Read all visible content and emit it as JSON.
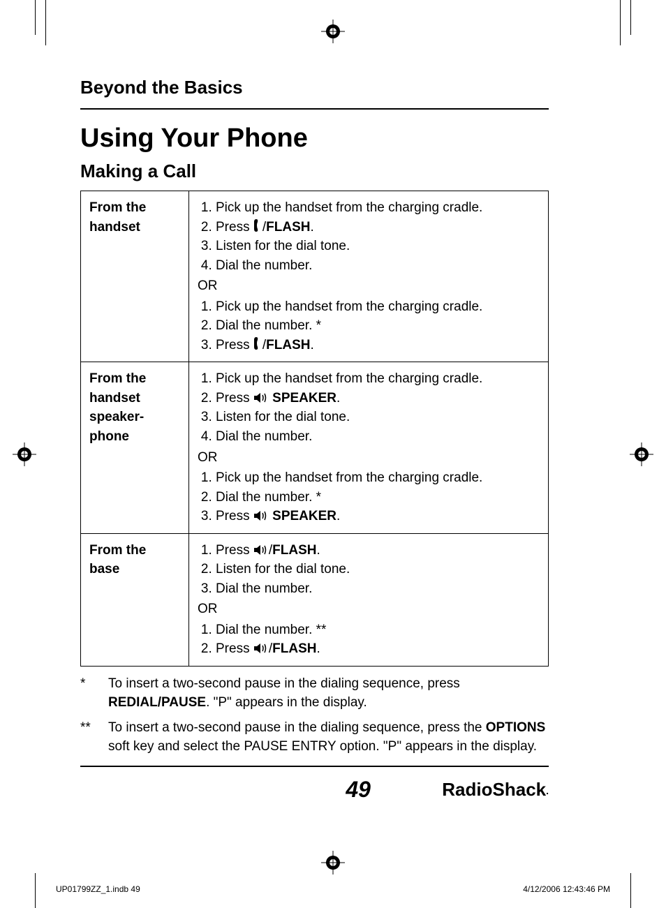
{
  "section_title": "Beyond the Basics",
  "main_title": "Using Your Phone",
  "sub_title": "Making a Call",
  "rows": [
    {
      "label": "From the handset",
      "steps_a": [
        "Pick up the handset from the charging cradle.",
        {
          "pre": "Press ",
          "icon": "handset",
          "post": "/",
          "bold": "FLASH",
          "end": "."
        },
        "Listen for the dial tone.",
        "Dial the number."
      ],
      "or": "OR",
      "steps_b": [
        "Pick up the handset from the charging cradle.",
        "Dial the number. *",
        {
          "pre": "Press ",
          "icon": "handset",
          "post": "/",
          "bold": "FLASH",
          "end": "."
        }
      ]
    },
    {
      "label": "From the handset speaker-phone",
      "steps_a": [
        "Pick up the handset from the charging cradle.",
        {
          "pre": "Press ",
          "icon": "speaker",
          "post": " ",
          "bold": "SPEAKER",
          "end": "."
        },
        "Listen for the dial tone.",
        "Dial the number."
      ],
      "or": "OR",
      "steps_b": [
        "Pick up the handset from the charging cradle.",
        "Dial the number. *",
        {
          "pre": "Press ",
          "icon": "speaker",
          "post": " ",
          "bold": "SPEAKER",
          "end": "."
        }
      ]
    },
    {
      "label": "From the base",
      "steps_a": [
        {
          "pre": "Press ",
          "icon": "speaker",
          "post": "/",
          "bold": "FLASH",
          "end": "."
        },
        "Listen for the dial tone.",
        "Dial the number."
      ],
      "or": "OR",
      "steps_b": [
        "Dial the number. **",
        {
          "pre": "Press ",
          "icon": "speaker",
          "post": "/",
          "bold": "FLASH",
          "end": "."
        }
      ]
    }
  ],
  "footnotes": [
    {
      "mark": "*",
      "text_pre": "To insert a two-second pause in the dialing sequence, press ",
      "bold": "REDIAL/PAUSE",
      "text_post": ". \"P\" appears in the display."
    },
    {
      "mark": "**",
      "text_pre": "To insert a two-second pause in the dialing sequence, press the ",
      "bold": "OPTIONS",
      "text_post": " soft key and select the PAUSE ENTRY option. \"P\" appears in the display."
    }
  ],
  "page_number": "49",
  "brand": "RadioShack",
  "print_left": "UP01799ZZ_1.indb   49",
  "print_right": "4/12/2006   12:43:46 PM"
}
